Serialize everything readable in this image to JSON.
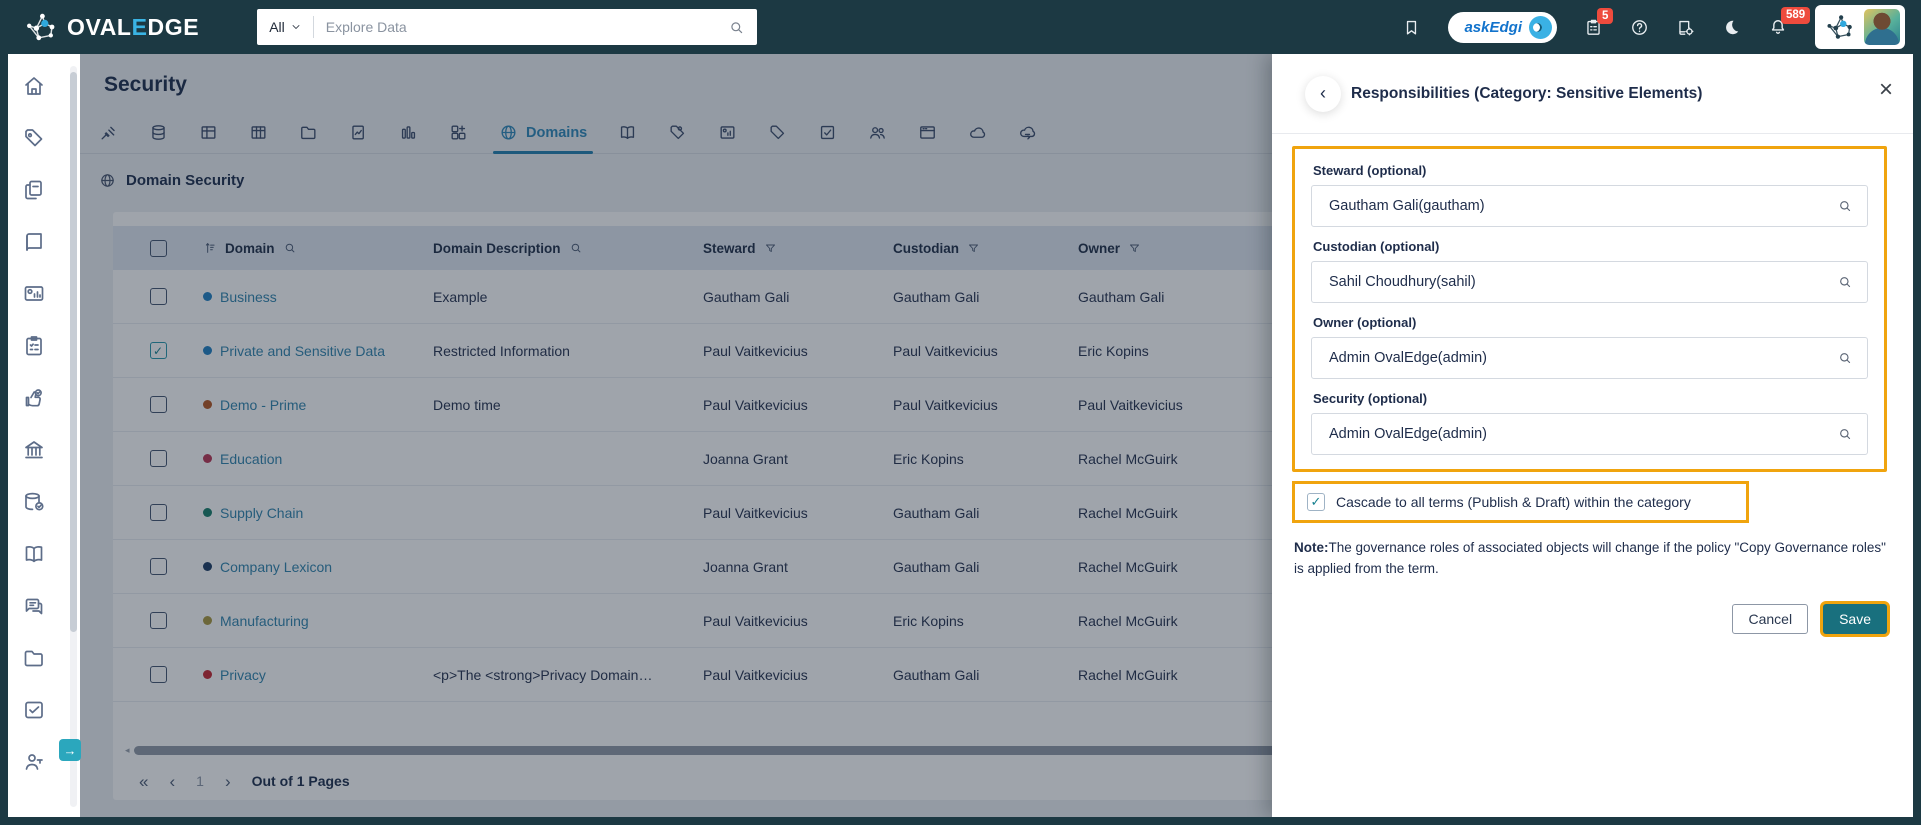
{
  "navbar": {
    "brand_prefix": "OVAL",
    "brand_accent": "E",
    "brand_suffix": "DGE",
    "search_scope": "All",
    "search_placeholder": "Explore Data",
    "askedgi_label": "askEdgi",
    "clipboard_badge": "5",
    "bell_badge": "589"
  },
  "sidebar": {
    "items": [
      "home",
      "tags",
      "documents",
      "catalog",
      "dashboards",
      "projects",
      "data-quality",
      "governance",
      "data-stores",
      "glossary",
      "collaboration",
      "files",
      "jobs",
      "access"
    ]
  },
  "page": {
    "title": "Security",
    "section_title": "Domain Security"
  },
  "tabs": {
    "icons_before": [
      "crawler",
      "database",
      "table",
      "table-columns",
      "folder",
      "file-report",
      "bar-chart",
      "components"
    ],
    "active": {
      "icon": "globe",
      "label": "Domains"
    },
    "icons_after": [
      "open-book",
      "tag-badge",
      "image-report",
      "tag",
      "check-square",
      "users",
      "card-view",
      "cloud",
      "cloud-sync"
    ]
  },
  "table": {
    "headers": {
      "domain": "Domain",
      "description": "Domain Description",
      "steward": "Steward",
      "custodian": "Custodian",
      "owner": "Owner"
    },
    "rows": [
      {
        "check": "",
        "dot": "#1E7FC2",
        "domain": "Business",
        "desc": "Example",
        "steward": "Gautham Gali",
        "custodian": "Gautham Gali",
        "owner": "Gautham Gali"
      },
      {
        "check": "✓",
        "dot": "#1E7FC2",
        "domain": "Private and Sensitive Data",
        "desc": "Restricted Information",
        "steward": "Paul Vaitkevicius",
        "custodian": "Paul Vaitkevicius",
        "owner": "Eric Kopins"
      },
      {
        "check": "",
        "dot": "#B3541E",
        "domain": "Demo - Prime",
        "desc": "Demo time",
        "steward": "Paul Vaitkevicius",
        "custodian": "Paul Vaitkevicius",
        "owner": "Paul Vaitkevicius"
      },
      {
        "check": "",
        "dot": "#B93352",
        "domain": "Education",
        "desc": "",
        "steward": "Joanna Grant",
        "custodian": "Eric Kopins",
        "owner": "Rachel McGuirk"
      },
      {
        "check": "",
        "dot": "#167D68",
        "domain": "Supply Chain",
        "desc": "",
        "steward": "Paul Vaitkevicius",
        "custodian": "Gautham Gali",
        "owner": "Rachel McGuirk"
      },
      {
        "check": "",
        "dot": "#1A3A63",
        "domain": "Company Lexicon",
        "desc": "",
        "steward": "Joanna Grant",
        "custodian": "Gautham Gali",
        "owner": "Rachel McGuirk"
      },
      {
        "check": "",
        "dot": "#A8973D",
        "domain": "Manufacturing",
        "desc": "",
        "steward": "Paul Vaitkevicius",
        "custodian": "Eric Kopins",
        "owner": "Rachel McGuirk"
      },
      {
        "check": "",
        "dot": "#C4242E",
        "domain": "Privacy",
        "desc": "<p>The <strong>Privacy Domain…",
        "steward": "Paul Vaitkevicius",
        "custodian": "Gautham Gali",
        "owner": "Rachel McGuirk"
      }
    ]
  },
  "pagination": {
    "first": "«",
    "prev": "‹",
    "page": "1",
    "next": "›",
    "label": "Out of 1 Pages"
  },
  "drawer": {
    "back": "‹",
    "title": "Responsibilities (Category: Sensitive Elements)",
    "close": "×",
    "fields": [
      {
        "label": "Steward (optional)",
        "value": "Gautham Gali(gautham)"
      },
      {
        "label": "Custodian (optional)",
        "value": "Sahil Choudhury(sahil)"
      },
      {
        "label": "Owner (optional)",
        "value": "Admin OvalEdge(admin)"
      },
      {
        "label": "Security (optional)",
        "value": "Admin OvalEdge(admin)"
      }
    ],
    "cascade_check": "✓",
    "cascade_label": "Cascade to all terms (Publish & Draft) within the category",
    "note_bold": "Note:",
    "note_text": "The governance roles of associated objects will change if the policy \"Copy Governance roles\" is applied from the term.",
    "cancel_label": "Cancel",
    "save_label": "Save"
  },
  "colors": {
    "accent_orange": "#F0A40E",
    "save_teal": "#19707E",
    "badge_red": "#EE4B3D",
    "link_blue": "#2F83AD",
    "navbar_bg": "#1C3943"
  }
}
